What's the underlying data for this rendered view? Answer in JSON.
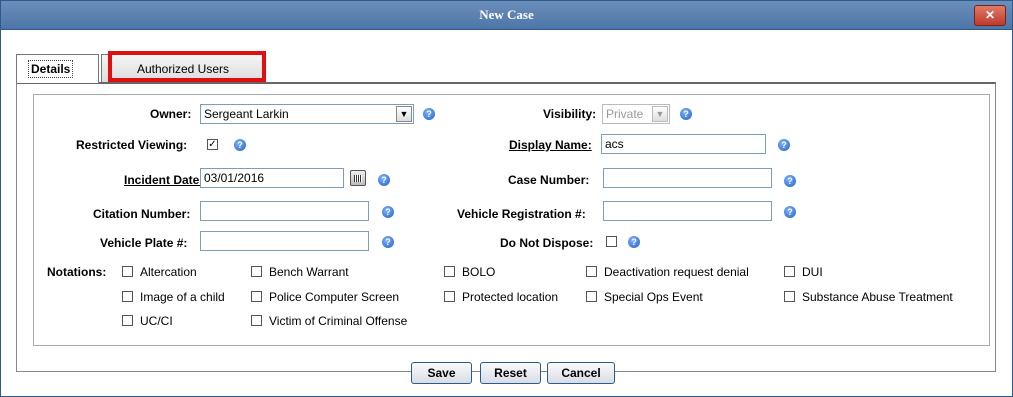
{
  "window": {
    "title": "New Case",
    "close_glyph": "✕"
  },
  "tabs": [
    {
      "label": "Details"
    },
    {
      "label": "Authorized Users"
    }
  ],
  "form": {
    "owner_label": "Owner:",
    "owner_value": "Sergeant Larkin",
    "visibility_label": "Visibility:",
    "visibility_value": "Private",
    "restricted_label": "Restricted Viewing:",
    "restricted_checked": "✓",
    "display_name_label": "Display Name:",
    "display_name_value": "acs",
    "incident_date_label": "Incident Date:",
    "incident_date_value": "03/01/2016",
    "case_number_label": "Case Number:",
    "case_number_value": "",
    "citation_label": "Citation Number:",
    "citation_value": "",
    "vehicle_reg_label": "Vehicle Registration #:",
    "vehicle_reg_value": "",
    "plate_label": "Vehicle Plate #:",
    "plate_value": "",
    "do_not_dispose_label": "Do Not Dispose:",
    "notations_label": "Notations:",
    "notations": [
      "Altercation",
      "Bench Warrant",
      "BOLO",
      "Deactivation request denial",
      "DUI",
      "Image of a child",
      "Police Computer Screen",
      "Protected location",
      "Special Ops Event",
      "Substance Abuse Treatment",
      "UC/CI",
      "Victim of Criminal Offense"
    ]
  },
  "buttons": {
    "save": "Save",
    "reset": "Reset",
    "cancel": "Cancel"
  },
  "colors": {
    "titlebar": "#5a7fb0",
    "highlight": "#e01010",
    "help_icon": "#1f5fc4"
  },
  "icons": {
    "help": "help-icon",
    "calendar": "calendar-icon",
    "dropdown": "chevron-down-icon"
  }
}
